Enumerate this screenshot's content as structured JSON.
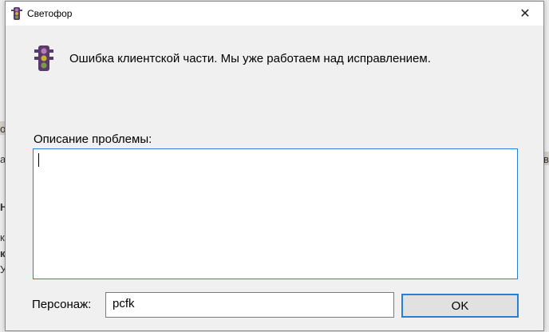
{
  "background": {
    "glyphs_left": [
      "о",
      "а",
      "Н",
      "к",
      "к",
      "У"
    ],
    "glyph_right": "во"
  },
  "window": {
    "title": "Светофор",
    "close_glyph": "✕",
    "icon": "traffic-light-icon"
  },
  "message": {
    "icon": "traffic-light-icon",
    "text": "Ошибка клиентской части. Мы уже работаем над исправлением."
  },
  "description": {
    "label": "Описание проблемы:",
    "value": ""
  },
  "character": {
    "label": "Персонаж:",
    "value": "pcfk"
  },
  "buttons": {
    "ok_label": "OK"
  },
  "colors": {
    "accent": "#2a7fd4",
    "traffic_light_body": "#5a3a6a",
    "light_red": "#b57ab8",
    "light_yellow": "#c9b030",
    "light_green": "#7a9a4a"
  }
}
